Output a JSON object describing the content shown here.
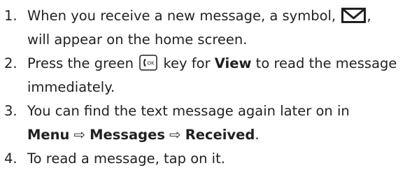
{
  "steps": [
    {
      "number": "1.",
      "line1_before": "When you receive a new message, a symbol, ",
      "icon": "envelope-icon",
      "line1_after": ",",
      "line2": "will appear on the home screen."
    },
    {
      "number": "2.",
      "before": "Press the green ",
      "icon": "ok-key-icon",
      "icon_text": "OK",
      "middle": " key for ",
      "bold": "View",
      "after": " to read the message",
      "line2": "immediately."
    },
    {
      "number": "3.",
      "line1": "You can find the text message again later on in",
      "path": [
        "Menu",
        "Messages",
        "Received"
      ],
      "arrow": "⇨",
      "end": "."
    },
    {
      "number": "4.",
      "text": "To read a message, tap on it."
    }
  ]
}
